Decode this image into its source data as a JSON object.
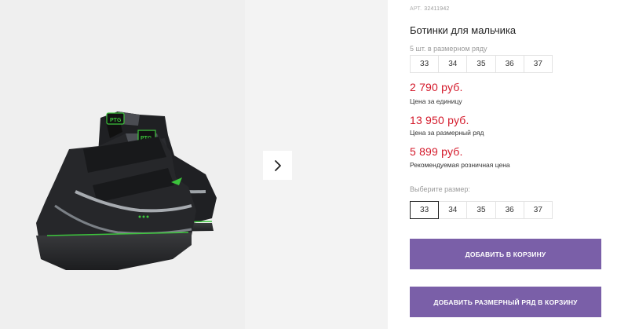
{
  "product": {
    "article_label": "АРТ.",
    "article": "32411942",
    "title": "Ботинки для мальчика",
    "pack_note": "5 шт. в размерном ряду",
    "pack_sizes": [
      "33",
      "34",
      "35",
      "36",
      "37"
    ],
    "price_unit": "2 790 руб.",
    "price_unit_note": "Цена за единицу",
    "price_row": "13 950 руб.",
    "price_row_note": "Цена за размерный ряд",
    "price_retail": "5 899 руб.",
    "price_retail_note": "Рекомендуемая розничная цена",
    "choose_size_label": "Выберите размер:",
    "sizes": [
      "33",
      "34",
      "35",
      "36",
      "37"
    ],
    "selected_size": "33"
  },
  "actions": {
    "add_to_cart": "ДОБАВИТЬ В КОРЗИНУ",
    "add_row_to_cart": "ДОБАВИТЬ РАЗМЕРНЫЙ РЯД В КОРЗИНУ"
  },
  "gallery": {
    "next_icon": "chevron-right-icon",
    "boot_logo": "PTG"
  },
  "colors": {
    "price": "#d4192a",
    "button": "#7a5fa8",
    "boot_accent": "#3cc43c"
  }
}
